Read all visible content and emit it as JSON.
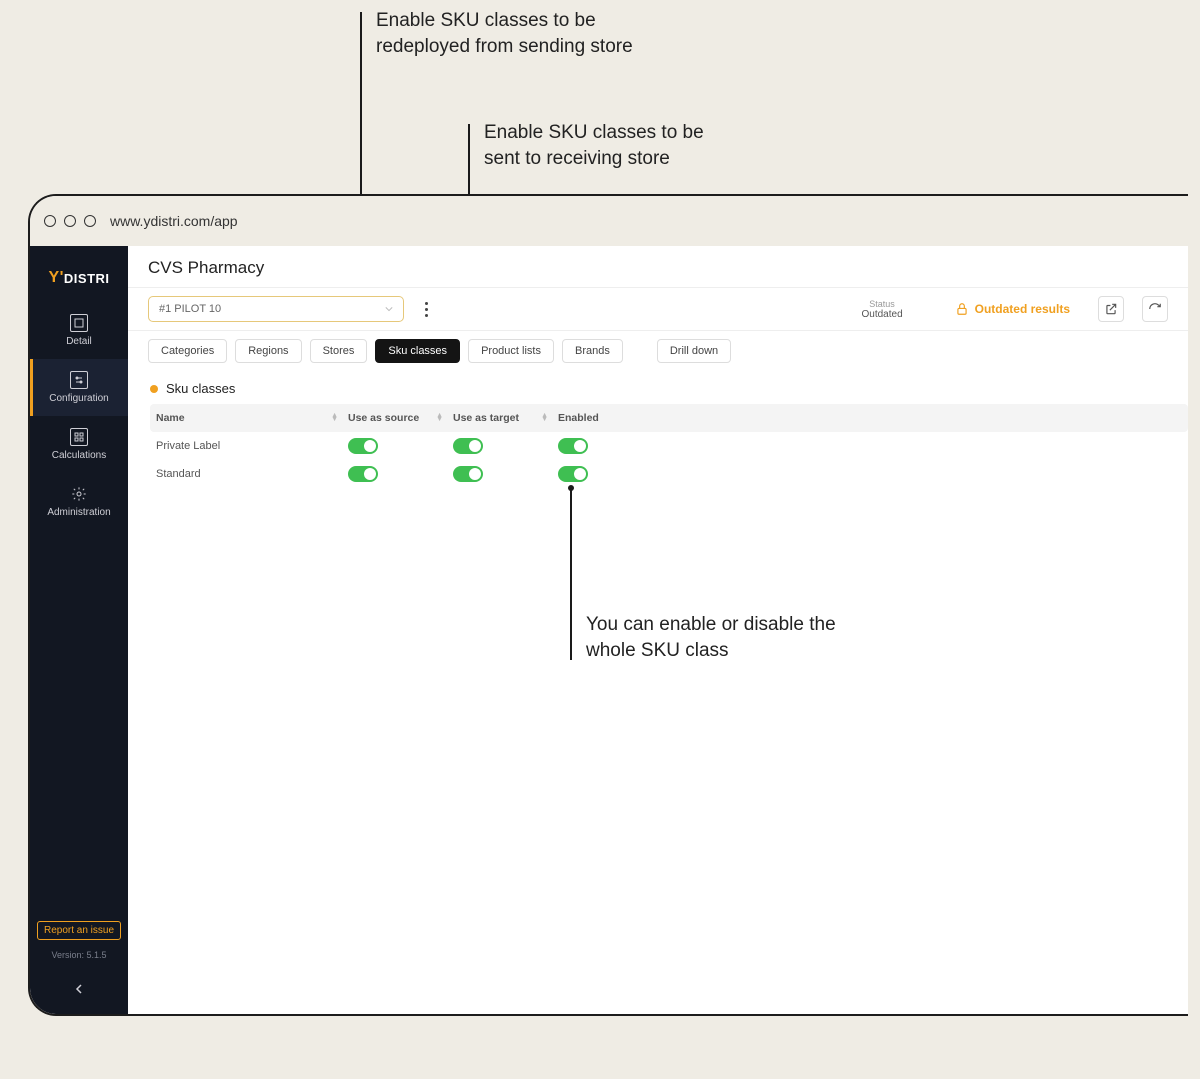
{
  "annotations": {
    "source": "Enable SKU classes to be redeployed from sending store",
    "target": "Enable SKU classes to be sent to receiving store",
    "enabled": "You can enable or disable the whole SKU class"
  },
  "browser": {
    "url": "www.ydistri.com/app"
  },
  "logo": {
    "prefix": "Y'",
    "rest": "DISTRI"
  },
  "sidebar": {
    "items": [
      {
        "label": "Detail"
      },
      {
        "label": "Configuration"
      },
      {
        "label": "Calculations"
      },
      {
        "label": "Administration"
      }
    ],
    "report": "Report an issue",
    "version": "Version: 5.1.5"
  },
  "header": {
    "title": "CVS Pharmacy"
  },
  "toolbar": {
    "selector": "#1  PILOT 10",
    "status_label": "Status",
    "status_value": "Outdated",
    "outdated": "Outdated results"
  },
  "tabs": [
    {
      "label": "Categories"
    },
    {
      "label": "Regions"
    },
    {
      "label": "Stores"
    },
    {
      "label": "Sku classes",
      "active": true
    },
    {
      "label": "Product lists"
    },
    {
      "label": "Brands"
    },
    {
      "label": "Drill down",
      "gap": true
    }
  ],
  "section": {
    "title": "Sku classes"
  },
  "table": {
    "headers": {
      "name": "Name",
      "source": "Use as source",
      "target": "Use as target",
      "enabled": "Enabled"
    },
    "rows": [
      {
        "name": "Private Label",
        "source": true,
        "target": true,
        "enabled": true
      },
      {
        "name": "Standard",
        "source": true,
        "target": true,
        "enabled": true
      }
    ]
  }
}
